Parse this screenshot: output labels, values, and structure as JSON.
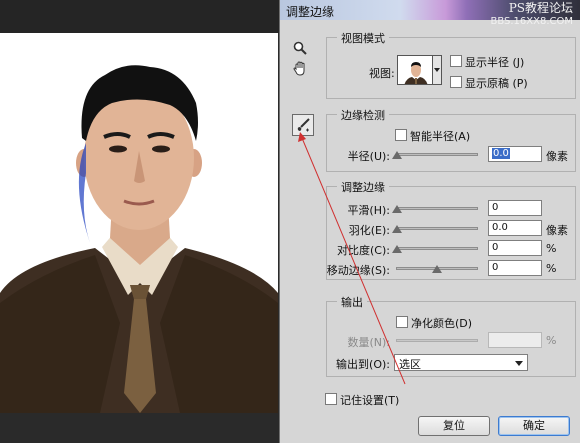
{
  "dialog": {
    "title": "调整边缘",
    "watermark_line1": "PS教程论坛",
    "watermark_line2": "BBS.16XX8.COM"
  },
  "tools": {
    "zoom_icon": "magnifier-icon",
    "hand_icon": "hand-icon",
    "refine_icon": "refine-radius-brush-icon"
  },
  "view_mode": {
    "group_title": "视图模式",
    "view_label": "视图:",
    "show_radius_label": "显示半径 (J)",
    "show_original_label": "显示原稿 (P)"
  },
  "edge_detection": {
    "group_title": "边缘检测",
    "smart_radius_label": "智能半径(A)",
    "radius_label": "半径(U):",
    "radius_value": "0.0",
    "radius_unit": "像素"
  },
  "adjust_edge": {
    "group_title": "调整边缘",
    "rows": [
      {
        "label": "平滑(H):",
        "value": "0",
        "unit": ""
      },
      {
        "label": "羽化(E):",
        "value": "0.0",
        "unit": "像素"
      },
      {
        "label": "对比度(C):",
        "value": "0",
        "unit": "%"
      },
      {
        "label": "移动边缘(S):",
        "value": "0",
        "unit": "%"
      }
    ]
  },
  "output": {
    "group_title": "输出",
    "decontaminate_label": "净化颜色(D)",
    "amount_label": "数量(N):",
    "amount_unit": "%",
    "output_to_label": "输出到(O):",
    "output_to_value": "选区"
  },
  "footer": {
    "remember_label": "记住设置(T)",
    "reset_button": "复位",
    "ok_button": "确定"
  },
  "colors": {
    "annotation_arrow": "#d03030",
    "ok_button_focus": "#3d7bd0",
    "suit": "#3e2e22",
    "shirt": "#e9dcc8",
    "tie": "#7b6040"
  }
}
